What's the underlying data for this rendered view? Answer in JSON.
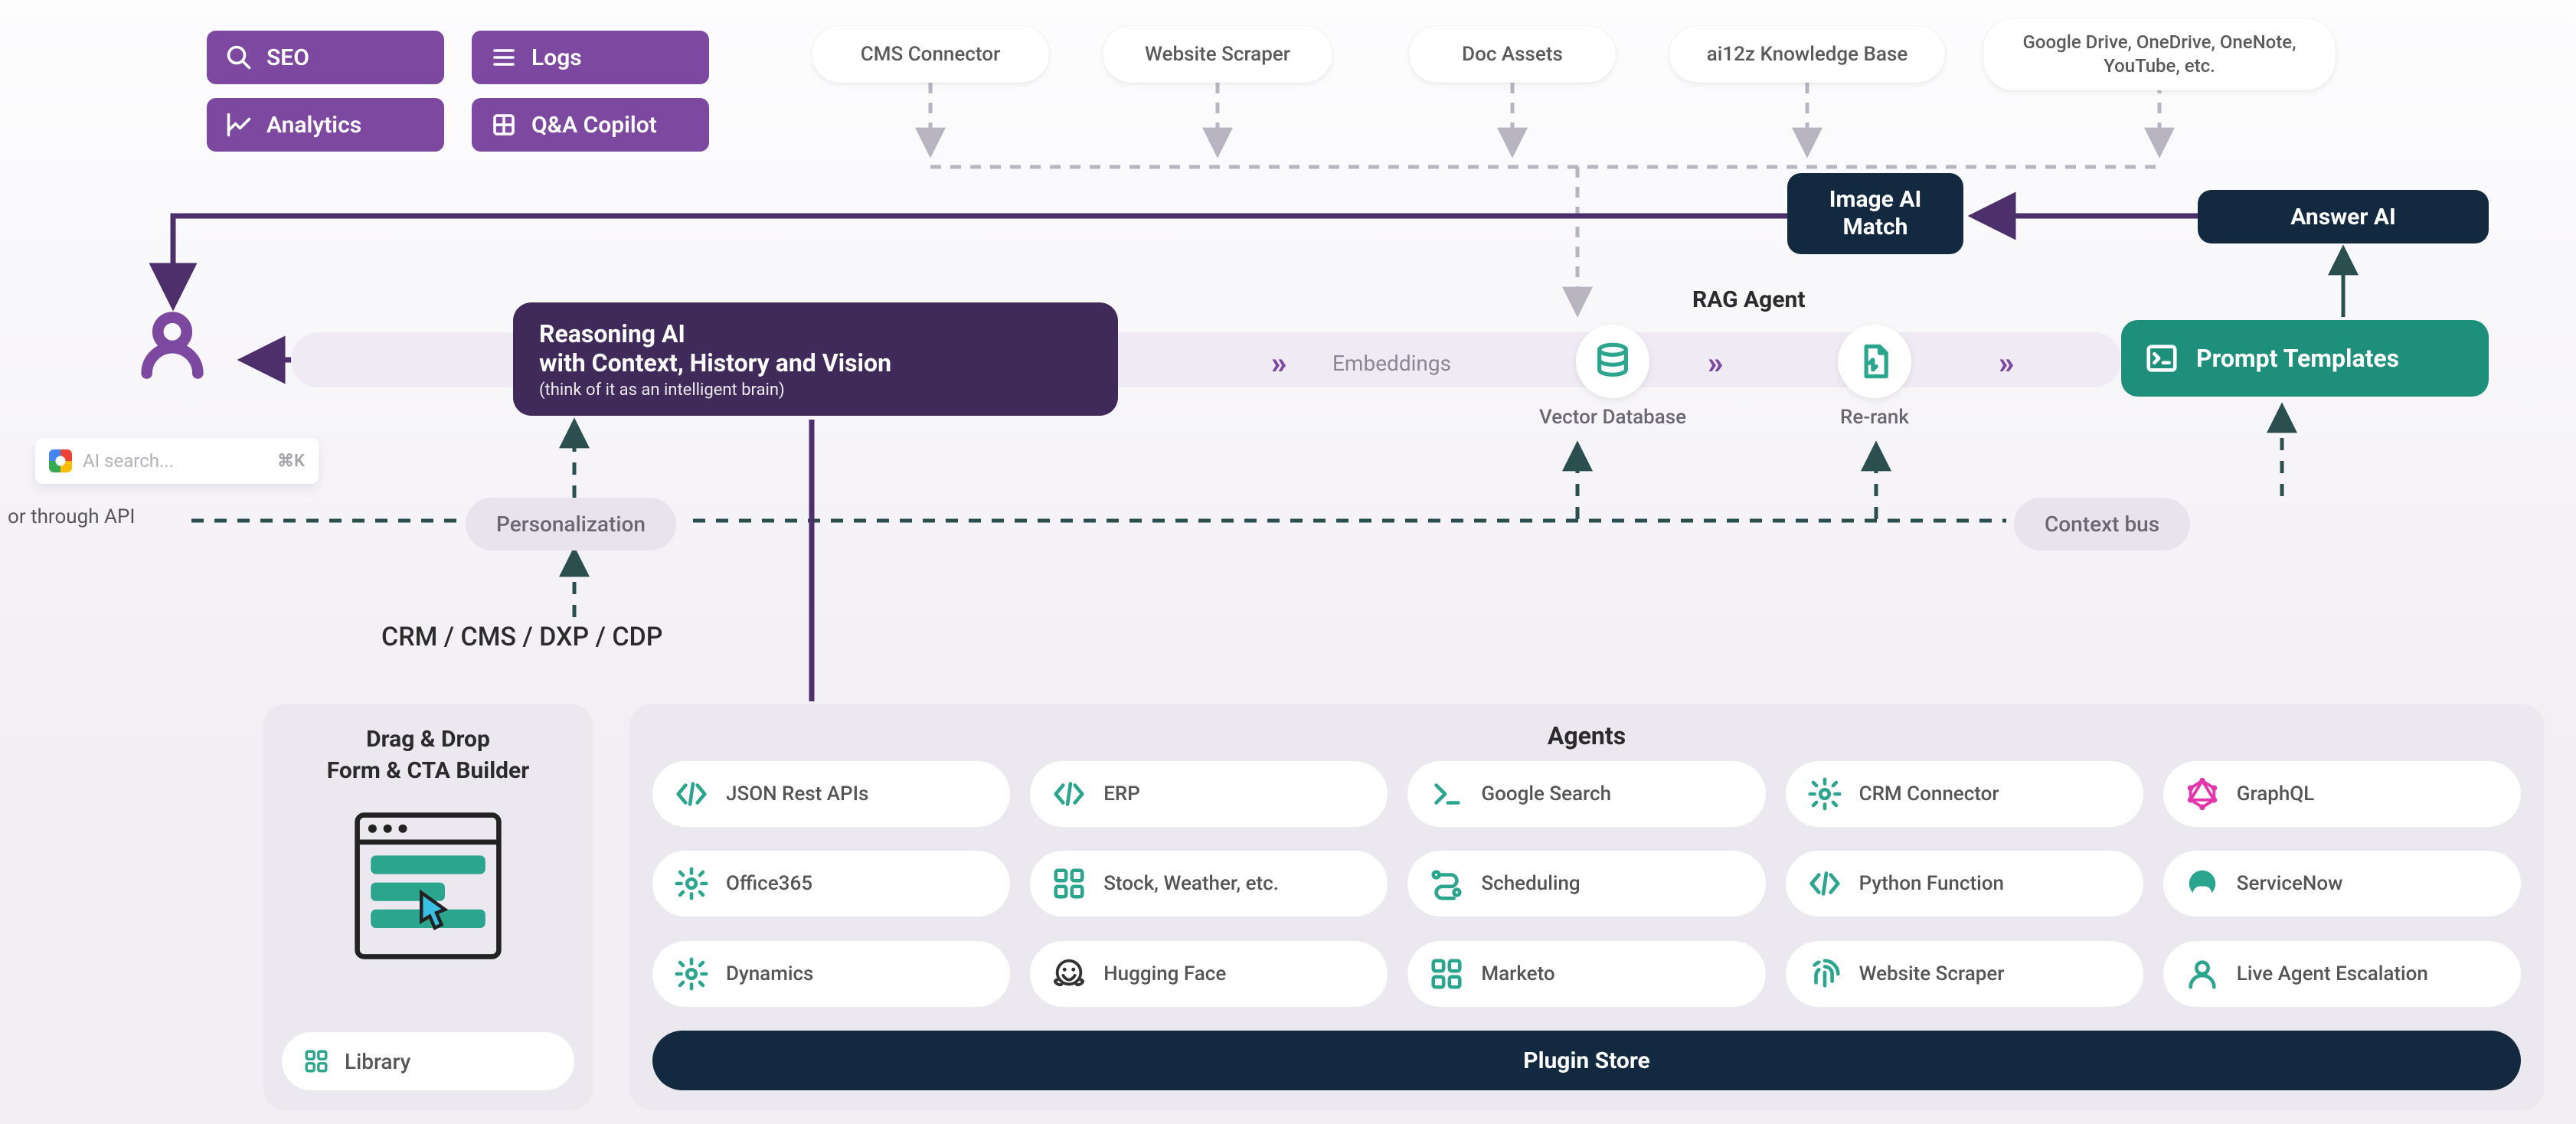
{
  "action_buttons": {
    "seo": "SEO",
    "logs": "Logs",
    "analytics": "Analytics",
    "qa_copilot": "Q&A Copilot"
  },
  "sources": {
    "cms_connector": "CMS Connector",
    "website_scraper": "Website Scraper",
    "doc_assets": "Doc Assets",
    "knowledge_base": "ai12z Knowledge Base",
    "cloud_drives": "Google Drive, OneDrive, OneNote, YouTube, etc."
  },
  "search": {
    "placeholder": "AI search...",
    "shortcut": "⌘K"
  },
  "api_note": "or through API",
  "reasoning": {
    "line1": "Reasoning AI",
    "line2": "with Context, History and Vision",
    "line3": "(think of it as an intelligent brain)"
  },
  "image_ai": "Image AI Match",
  "answer_ai": "Answer AI",
  "prompt_templates": "Prompt Templates",
  "pipeline": {
    "embeddings": "Embeddings",
    "vector_db": "Vector Database",
    "rerank": "Re-rank",
    "rag_agent": "RAG Agent"
  },
  "personalization": "Personalization",
  "context_bus": "Context bus",
  "crm_note": "CRM / CMS / DXP / CDP",
  "builder": {
    "line1": "Drag & Drop",
    "line2": "Form & CTA Builder",
    "library": "Library"
  },
  "agents": {
    "title": "Agents",
    "items": [
      {
        "label": "JSON Rest APIs",
        "icon": "code"
      },
      {
        "label": "ERP",
        "icon": "code"
      },
      {
        "label": "Google Search",
        "icon": "terminal"
      },
      {
        "label": "CRM Connector",
        "icon": "gear"
      },
      {
        "label": "GraphQL",
        "icon": "graphql"
      },
      {
        "label": "Office365",
        "icon": "gear"
      },
      {
        "label": "Stock, Weather, etc.",
        "icon": "grid"
      },
      {
        "label": "Scheduling",
        "icon": "route"
      },
      {
        "label": "Python Function",
        "icon": "code"
      },
      {
        "label": "ServiceNow",
        "icon": "servicenow"
      },
      {
        "label": "Dynamics",
        "icon": "gear"
      },
      {
        "label": "Hugging Face",
        "icon": "hugface"
      },
      {
        "label": "Marketo",
        "icon": "grid"
      },
      {
        "label": "Website Scraper",
        "icon": "fingerprint"
      },
      {
        "label": "Live Agent Escalation",
        "icon": "user"
      }
    ],
    "plugin_store": "Plugin Store"
  }
}
